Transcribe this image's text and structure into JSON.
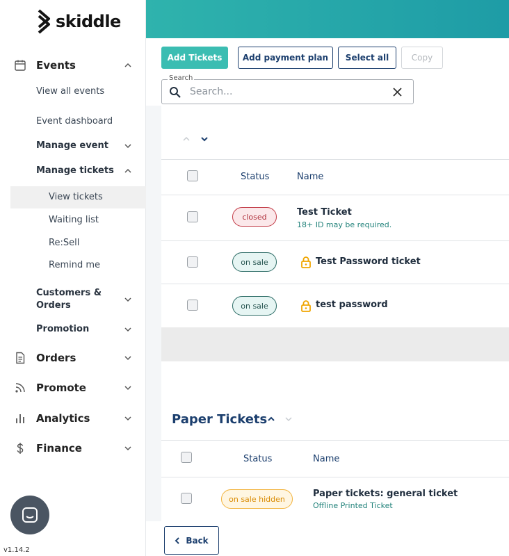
{
  "brand": {
    "name": "skiddle"
  },
  "sidebar": {
    "events": {
      "label": "Events",
      "icon": "calendar-icon"
    },
    "events_items": [
      {
        "label": "View all events"
      },
      {
        "label": "Event dashboard"
      },
      {
        "label": "Manage event"
      },
      {
        "label": "Manage tickets"
      }
    ],
    "ticket_items": [
      {
        "label": "View tickets",
        "active": true
      },
      {
        "label": "Waiting list"
      },
      {
        "label": "Re:Sell"
      },
      {
        "label": "Remind me"
      }
    ],
    "customers_orders": {
      "line1": "Customers &",
      "line2": "Orders"
    },
    "promotion": {
      "label": "Promotion"
    },
    "orders": {
      "label": "Orders",
      "icon": "document-icon"
    },
    "promote": {
      "label": "Promote",
      "icon": "rss-icon"
    },
    "analytics": {
      "label": "Analytics",
      "icon": "bar-chart-icon"
    },
    "finance": {
      "label": "Finance",
      "icon": "dollar-icon"
    },
    "version": "v1.14.2"
  },
  "toolbar": {
    "add_tickets": "Add Tickets",
    "add_payment_plan": "Add payment plan",
    "select_all": "Select all",
    "copy": "Copy"
  },
  "search": {
    "legend": "Search",
    "placeholder": "Search..."
  },
  "table": {
    "headers": {
      "status": "Status",
      "name": "Name"
    },
    "rows": [
      {
        "status": "closed",
        "name": "Test Ticket",
        "note": "18+ ID may be required."
      },
      {
        "status": "on sale",
        "name": "Test Password ticket",
        "locked": true
      },
      {
        "status": "on sale",
        "name": "test password",
        "locked": true
      }
    ]
  },
  "paper_tickets": {
    "title": "Paper Tickets",
    "headers": {
      "status": "Status",
      "name": "Name"
    },
    "rows": [
      {
        "status": "on sale hidden",
        "name": "Paper tickets: general ticket",
        "note": "Offline Printed Ticket"
      }
    ]
  },
  "footer": {
    "back": "Back"
  },
  "colors": {
    "teal": "#3bbdb2",
    "navy": "#1c3f6e",
    "closed": "#c23a46",
    "hidden": "#f2b23a"
  }
}
